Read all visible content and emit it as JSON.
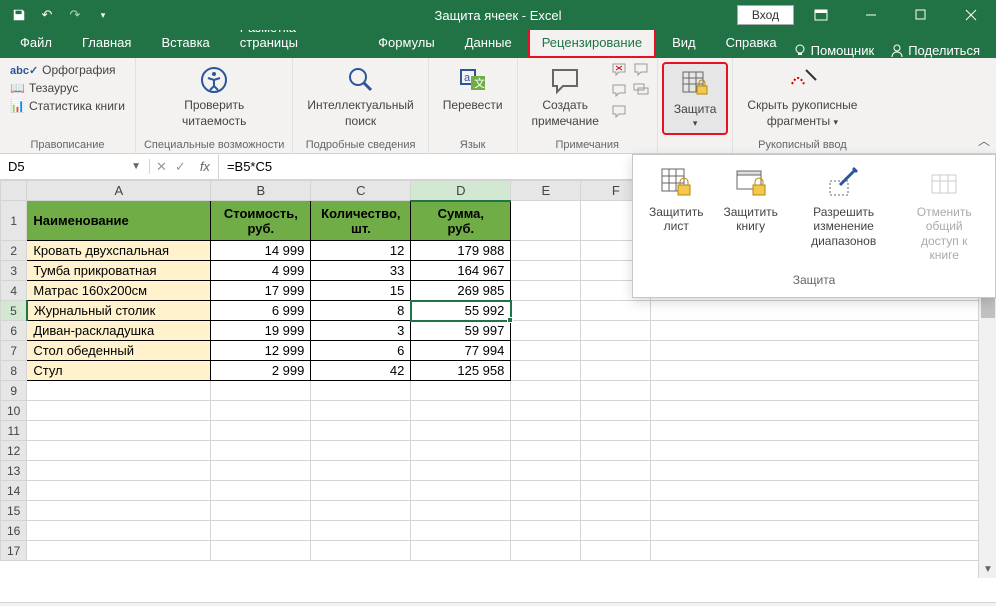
{
  "window": {
    "title": "Защита ячеек  -  Excel",
    "login": "Вход"
  },
  "tabs": {
    "file": "Файл",
    "home": "Главная",
    "insert": "Вставка",
    "layout": "Разметка страницы",
    "formulas": "Формулы",
    "data": "Данные",
    "review": "Рецензирование",
    "view": "Вид",
    "help": "Справка",
    "assistant": "Помощник",
    "share": "Поделиться"
  },
  "ribbon": {
    "proofing": {
      "spelling": "Орфография",
      "thesaurus": "Тезаурус",
      "stats": "Статистика книги",
      "label": "Правописание"
    },
    "accessibility": {
      "check1": "Проверить",
      "check2": "читаемость",
      "label": "Специальные возможности"
    },
    "insights": {
      "smart1": "Интеллектуальный",
      "smart2": "поиск",
      "label": "Подробные сведения"
    },
    "language": {
      "translate": "Перевести",
      "label": "Язык"
    },
    "comments": {
      "new1": "Создать",
      "new2": "примечание",
      "label": "Примечания"
    },
    "protect": {
      "btn": "Защита",
      "label": ""
    },
    "ink": {
      "hide1": "Скрыть рукописные",
      "hide2": "фрагменты",
      "label": "Рукописный ввод"
    }
  },
  "protect_dropdown": {
    "sheet1": "Защитить",
    "sheet2": "лист",
    "book1": "Защитить",
    "book2": "книгу",
    "ranges1": "Разрешить изменение",
    "ranges2": "диапазонов",
    "unshare1": "Отменить общий",
    "unshare2": "доступ к книге",
    "label": "Защита"
  },
  "formula_bar": {
    "name": "D5",
    "formula": "=B5*C5"
  },
  "columns": [
    "A",
    "B",
    "C",
    "D",
    "E",
    "F"
  ],
  "headers": {
    "name": "Наименование",
    "cost1": "Стоимость,",
    "cost2": "руб.",
    "qty1": "Количество,",
    "qty2": "шт.",
    "sum1": "Сумма,",
    "sum2": "руб."
  },
  "rows": [
    {
      "n": "Кровать двухспальная",
      "c": "14 999",
      "q": "12",
      "s": "179 988"
    },
    {
      "n": "Тумба прикроватная",
      "c": "4 999",
      "q": "33",
      "s": "164 967"
    },
    {
      "n": "Матрас 160х200см",
      "c": "17 999",
      "q": "15",
      "s": "269 985"
    },
    {
      "n": "Журнальный столик",
      "c": "6 999",
      "q": "8",
      "s": "55 992"
    },
    {
      "n": "Диван-раскладушка",
      "c": "19 999",
      "q": "3",
      "s": "59 997"
    },
    {
      "n": "Стол обеденный",
      "c": "12 999",
      "q": "6",
      "s": "77 994"
    },
    {
      "n": "Стул",
      "c": "2 999",
      "q": "42",
      "s": "125 958"
    }
  ]
}
